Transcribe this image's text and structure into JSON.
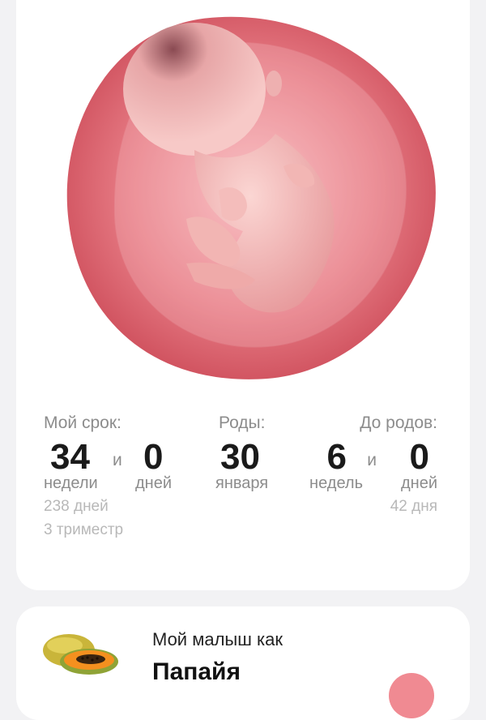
{
  "term": {
    "label": "Мой срок:",
    "weeks": "34",
    "weeks_unit": "недели",
    "connector": "и",
    "days": "0",
    "days_unit": "дней",
    "total_days": "238 дней",
    "trimester": "3 триместр"
  },
  "birth": {
    "label": "Роды:",
    "day": "30",
    "month": "января"
  },
  "until": {
    "label": "До родов:",
    "weeks": "6",
    "weeks_unit": "недель",
    "connector": "и",
    "days": "0",
    "days_unit": "дней",
    "total_days": "42 дня"
  },
  "baby": {
    "label": "Мой малыш как",
    "fruit": "Папайя"
  },
  "colors": {
    "uterus": "#d9616c",
    "accent": "#f08a92"
  }
}
